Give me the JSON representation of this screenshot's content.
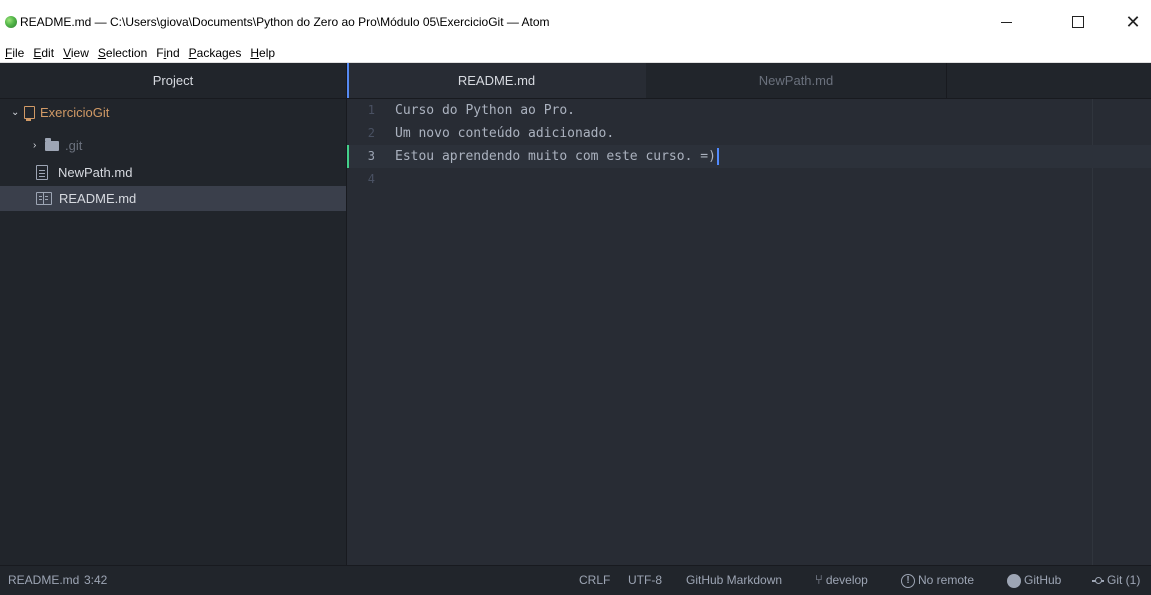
{
  "window": {
    "title": "README.md — C:\\Users\\giova\\Documents\\Python do Zero ao Pro\\Módulo 05\\ExercicioGit — Atom",
    "controls": {
      "minimize": "–",
      "maximize": "□",
      "close": "✕"
    }
  },
  "menu": [
    {
      "mn": "F",
      "rest": "ile"
    },
    {
      "mn": "E",
      "rest": "dit"
    },
    {
      "mn": "V",
      "rest": "iew"
    },
    {
      "mn": "S",
      "rest": "election"
    },
    {
      "pre": "F",
      "mn": "i",
      "rest": "nd"
    },
    {
      "mn": "P",
      "rest": "ackages"
    },
    {
      "mn": "H",
      "rest": "elp"
    }
  ],
  "sidebar": {
    "header": "Project",
    "tree": {
      "root": "ExercicioGit",
      "git_folder": ".git",
      "file_newpath": "NewPath.md",
      "file_readme": "README.md"
    }
  },
  "tabs": {
    "active": "README.md",
    "inactive": "NewPath.md"
  },
  "editor": {
    "lines": [
      {
        "num": "1",
        "text": "Curso do Python ao Pro."
      },
      {
        "num": "2",
        "text": "Um novo conteúdo adicionado."
      },
      {
        "num": "3",
        "text": "Estou aprendendo muito com este curso. =)"
      },
      {
        "num": "4",
        "text": ""
      }
    ],
    "cursor_line": 3
  },
  "status": {
    "file": "README.md",
    "position": "3:42",
    "line_ending": "CRLF",
    "encoding": "UTF-8",
    "grammar": "GitHub Markdown",
    "branch": "develop",
    "remote": "No remote",
    "github": "GitHub",
    "git": "Git (1)"
  },
  "colors": {
    "accent": "#568af2",
    "git_added": "#43d08a",
    "project_root": "#d19a66"
  }
}
